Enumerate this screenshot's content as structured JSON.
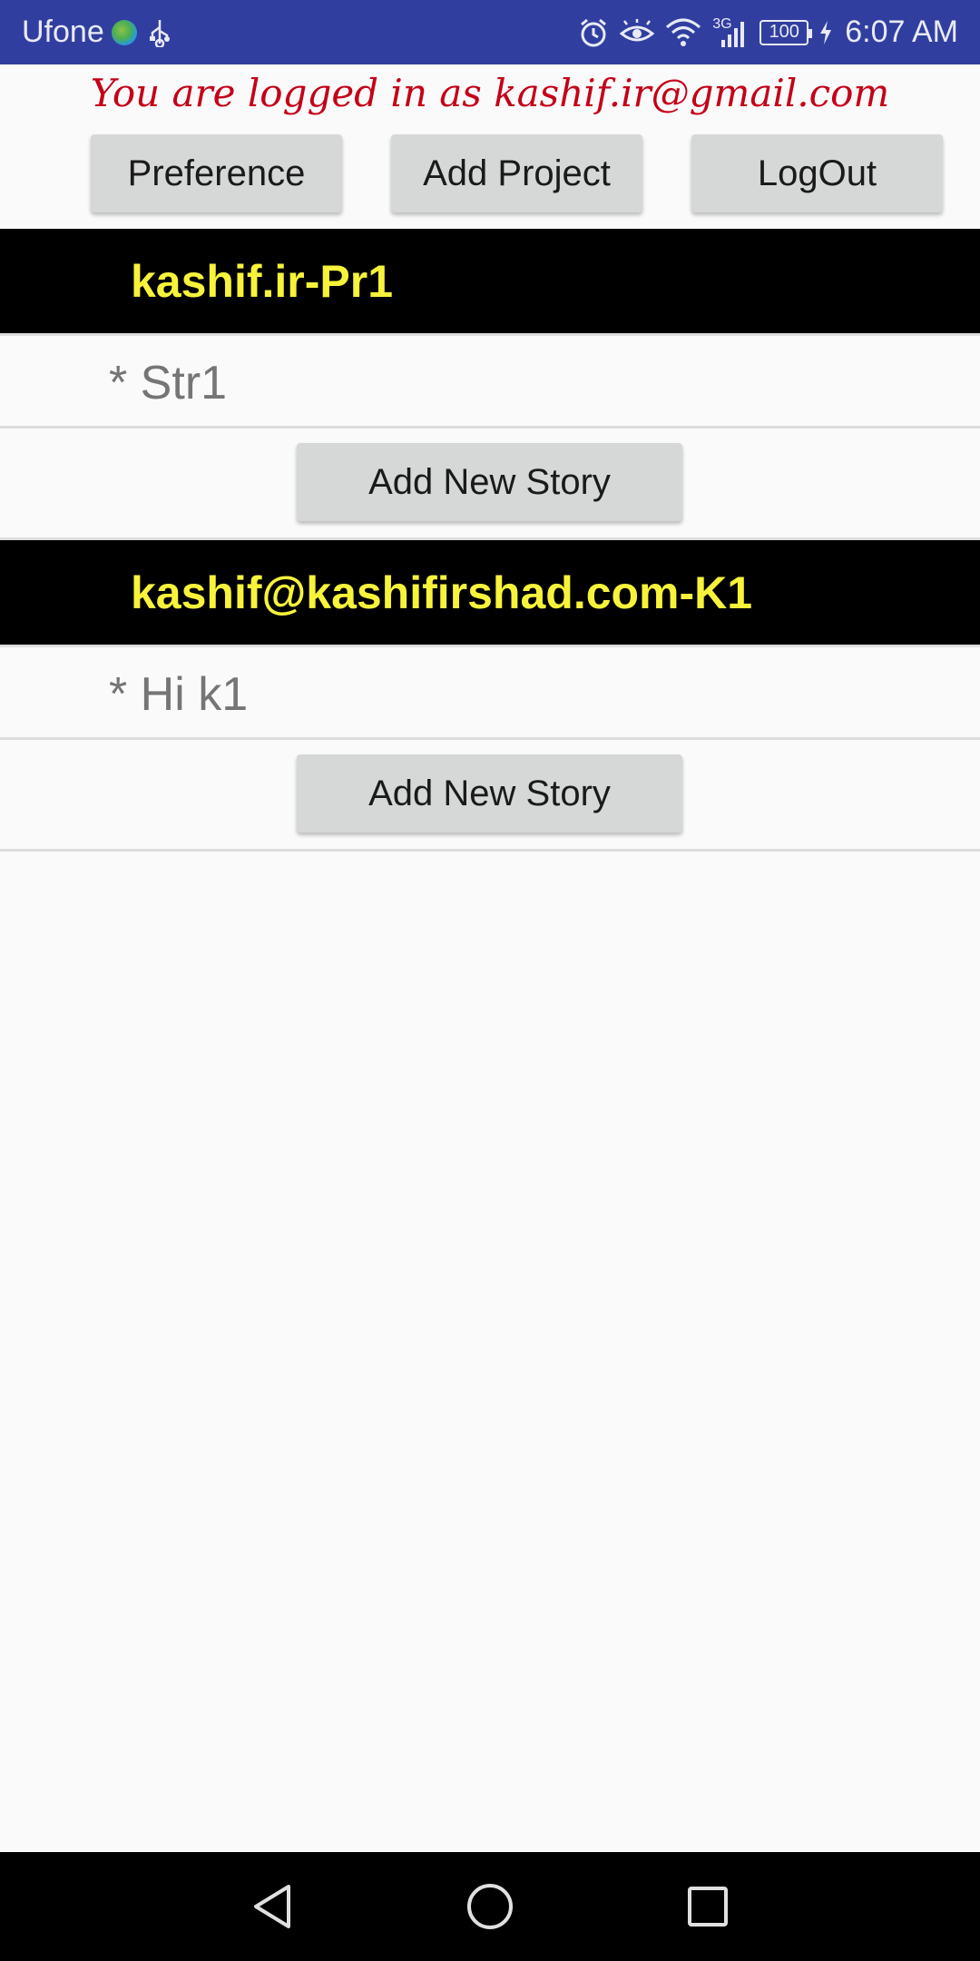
{
  "status_bar": {
    "carrier": "Ufone",
    "battery": "100",
    "network": "3G",
    "time": "6:07 AM",
    "icons": [
      "globe-icon",
      "usb-icon",
      "alarm-icon",
      "eye-icon",
      "wifi-icon",
      "signal-icon",
      "battery-icon",
      "charging-icon"
    ]
  },
  "header": {
    "logged_in_text": "You are logged in as kashif.ir@gmail.com",
    "color": "#c40018"
  },
  "toolbar": {
    "preference_label": "Preference",
    "add_project_label": "Add Project",
    "logout_label": "LogOut"
  },
  "projects": [
    {
      "title": "kashif.ir-Pr1",
      "stories": [
        "* Str1"
      ],
      "add_story_label": "Add New Story"
    },
    {
      "title": "kashif@kashifirshad.com-K1",
      "stories": [
        "* Hi k1"
      ],
      "add_story_label": "Add New Story"
    }
  ],
  "colors": {
    "status_bar": "#303f9f",
    "project_header_bg": "#000000",
    "project_header_text": "#f6f33a",
    "button_bg": "#d6d7d7"
  },
  "nav_bar": {
    "icons": [
      "back-icon",
      "home-icon",
      "recents-icon"
    ]
  }
}
